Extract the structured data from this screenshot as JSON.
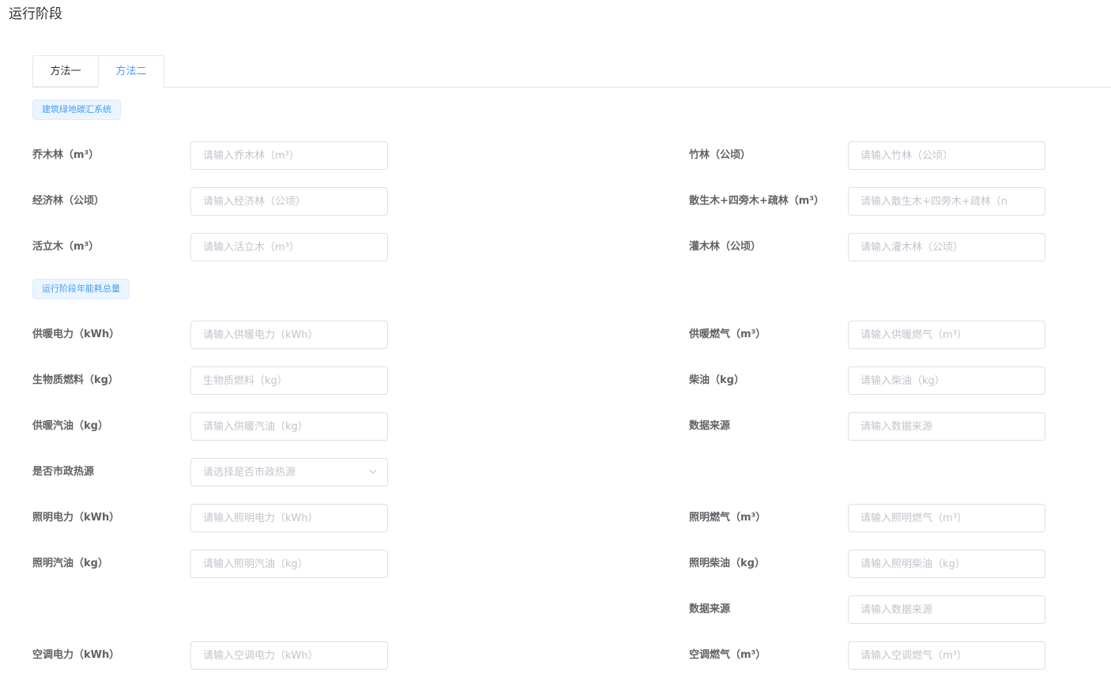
{
  "page": {
    "title": "运行阶段"
  },
  "tabs": [
    {
      "label": "方法一",
      "active": false
    },
    {
      "label": "方法二",
      "active": true
    }
  ],
  "sections": {
    "carbon_sink": "建筑绿地碳汇系统",
    "energy": "运行阶段年能耗总量"
  },
  "fields": {
    "arbor": {
      "label": "乔木林（m³）",
      "placeholder": "请输入乔木林（m³）"
    },
    "bamboo": {
      "label": "竹林（公顷）",
      "placeholder": "请输入竹林（公顷）"
    },
    "economic": {
      "label": "经济林（公顷）",
      "placeholder": "请输入经济林（公顷）"
    },
    "scattered": {
      "label": "散生木+四旁木+疏林（m³）",
      "placeholder": "请输入散生木+四旁木+疏林（n"
    },
    "standing": {
      "label": "活立木（m³）",
      "placeholder": "请输入活立木（m³）"
    },
    "shrub": {
      "label": "灌木林（公顷）",
      "placeholder": "请输入灌木林（公顷）"
    },
    "heat_elec": {
      "label": "供暖电力（kWh）",
      "placeholder": "请输入供暖电力（kWh）"
    },
    "heat_gas": {
      "label": "供暖燃气（m³）",
      "placeholder": "请输入供暖燃气（m³）"
    },
    "biomass": {
      "label": "生物质燃料（kg）",
      "placeholder": "生物质燃料（kg）"
    },
    "diesel": {
      "label": "柴油（kg）",
      "placeholder": "请输入柴油（kg）"
    },
    "heat_petrol": {
      "label": "供暖汽油（kg）",
      "placeholder": "请输入供暖汽油（kg）"
    },
    "source1": {
      "label": "数据来源",
      "placeholder": "请输入数据来源"
    },
    "municipal": {
      "label": "是否市政热源",
      "placeholder": "请选择是否市政热源"
    },
    "light_elec": {
      "label": "照明电力（kWh）",
      "placeholder": "请输入照明电力（kWh）"
    },
    "light_gas": {
      "label": "照明燃气（m³）",
      "placeholder": "请输入照明燃气（m³）"
    },
    "light_petrol": {
      "label": "照明汽油（kg）",
      "placeholder": "请输入照明汽油（kg）"
    },
    "light_diesel": {
      "label": "照明柴油（kg）",
      "placeholder": "请输入照明柴油（kg）"
    },
    "source2": {
      "label": "数据来源",
      "placeholder": "请输入数据来源"
    },
    "ac_elec": {
      "label": "空调电力（kWh）",
      "placeholder": "请输入空调电力（kWh）"
    },
    "ac_gas": {
      "label": "空调燃气（m³）",
      "placeholder": "请输入空调燃气（m³）"
    }
  },
  "icons": {
    "select_arrow": "chevron-down-icon"
  },
  "colors": {
    "accent": "#409eff",
    "tag_bg": "#ecf5ff",
    "border": "#dcdfe6",
    "placeholder": "#c0c4cc"
  }
}
